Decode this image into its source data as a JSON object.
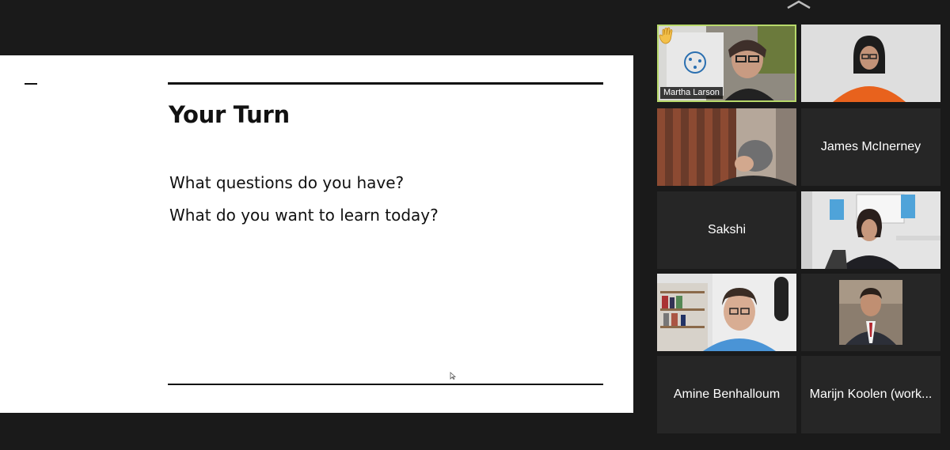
{
  "slide": {
    "title": "Your Turn",
    "lines": [
      "What questions do you have?",
      "What do you want to learn today?"
    ]
  },
  "participants": [
    {
      "name": "Martha Larson",
      "video": true,
      "active_speaker": true,
      "hand_raised": true
    },
    {
      "name": "",
      "video": true
    },
    {
      "name": "",
      "video": true
    },
    {
      "name": "James McInerney",
      "video": false
    },
    {
      "name": "Sakshi",
      "video": false
    },
    {
      "name": "",
      "video": true
    },
    {
      "name": "",
      "video": true
    },
    {
      "name": "",
      "video": true
    },
    {
      "name": "Amine Benhalloum",
      "video": false
    },
    {
      "name": "Marijn Koolen (work...",
      "video": false
    }
  ],
  "colors": {
    "background": "#1a1a1a",
    "tile": "#262626",
    "active_border": "#b8d96b",
    "slide": "#ffffff"
  },
  "icons": [
    "chevron-up-icon",
    "raised-hand-icon",
    "mouse-pointer-icon"
  ]
}
